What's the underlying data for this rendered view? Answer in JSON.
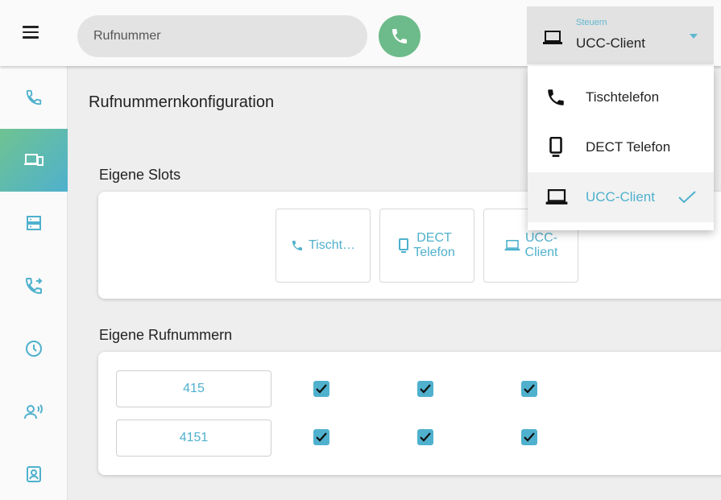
{
  "header": {
    "search_placeholder": "Rufnummer",
    "device_selector": {
      "small_label": "Steuern",
      "value": "UCC-Client"
    }
  },
  "sidebar": {
    "items": [
      {
        "icon": "phone-icon"
      },
      {
        "icon": "devices-icon",
        "active": true
      },
      {
        "icon": "server-icon"
      },
      {
        "icon": "call-forward-icon"
      },
      {
        "icon": "clock-icon"
      },
      {
        "icon": "voice-icon"
      },
      {
        "icon": "contact-icon"
      }
    ]
  },
  "main": {
    "title": "Rufnummernkonfiguration",
    "slots_title": "Eigene Slots",
    "slots": [
      {
        "label": "Tischt…",
        "icon": "phone-icon"
      },
      {
        "label": "DECT\nTelefon",
        "icon": "mobile-icon"
      },
      {
        "label": "UCC-\nClient",
        "icon": "laptop-icon"
      }
    ],
    "numbers_title": "Eigene Rufnummern",
    "numbers": [
      {
        "value": "415",
        "checks": [
          true,
          true,
          true
        ]
      },
      {
        "value": "4151",
        "checks": [
          true,
          true,
          true
        ]
      }
    ]
  },
  "dropdown": {
    "items": [
      {
        "label": "Tischtelefon",
        "icon": "phone-icon"
      },
      {
        "label": "DECT Telefon",
        "icon": "mobile-icon"
      },
      {
        "label": "UCC-Client",
        "icon": "laptop-icon",
        "selected": true
      }
    ]
  },
  "colors": {
    "accent": "#4fb1cd",
    "call_green": "#6dbb8a",
    "gradient_start": "#6fc391",
    "gradient_end": "#4fb1cd"
  }
}
